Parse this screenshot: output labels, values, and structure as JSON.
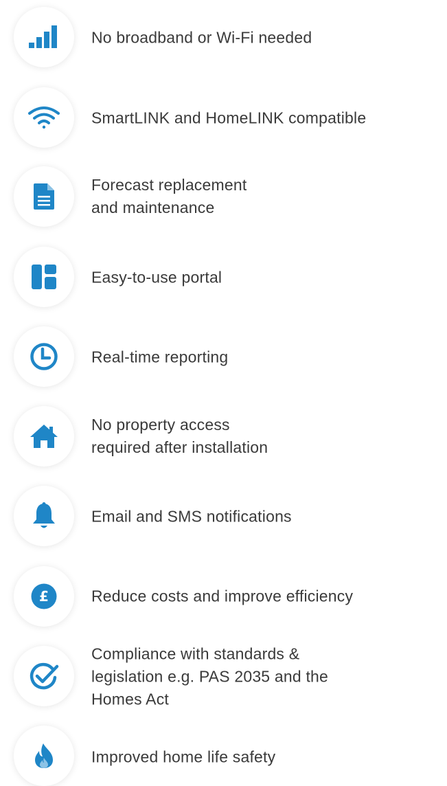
{
  "accent_color": "#1f86c7",
  "features": [
    {
      "icon": "signal-bars-icon",
      "text": "No broadband or Wi-Fi needed"
    },
    {
      "icon": "wifi-icon",
      "text": "SmartLINK and HomeLINK compatible"
    },
    {
      "icon": "document-icon",
      "text": "Forecast replacement\nand maintenance"
    },
    {
      "icon": "dashboard-icon",
      "text": "Easy-to-use portal"
    },
    {
      "icon": "clock-icon",
      "text": "Real-time reporting"
    },
    {
      "icon": "home-icon",
      "text": "No property access\nrequired after installation"
    },
    {
      "icon": "bell-icon",
      "text": "Email and SMS notifications"
    },
    {
      "icon": "pound-coin-icon",
      "text": "Reduce costs and improve efficiency"
    },
    {
      "icon": "check-circle-icon",
      "text": "Compliance with standards &\nlegislation e.g. PAS 2035 and the\nHomes Act"
    },
    {
      "icon": "flame-icon",
      "text": "Improved home life safety"
    }
  ]
}
